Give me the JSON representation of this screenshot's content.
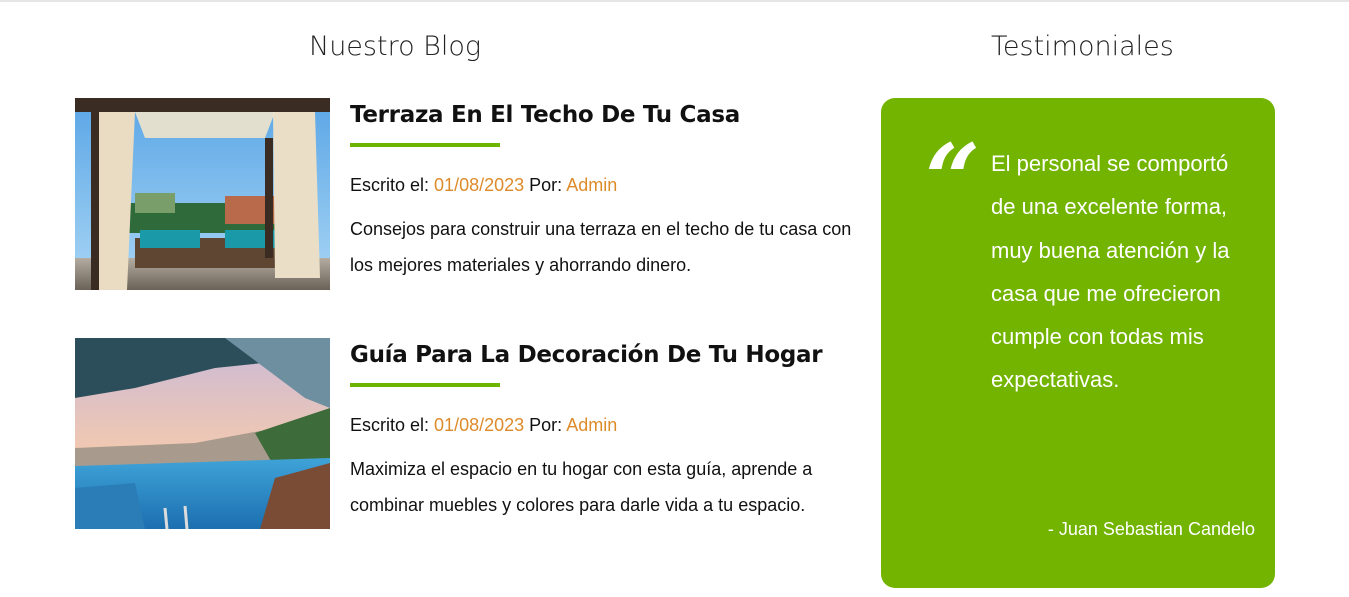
{
  "blog": {
    "heading": "Nuestro Blog",
    "posts": [
      {
        "title": "Terraza En El Techo De Tu Casa",
        "meta_written": "Escrito el:",
        "date": "01/08/2023",
        "meta_by": "Por:",
        "author": "Admin",
        "excerpt": "Consejos para construir una terraza en el techo de tu casa con los mejores materiales y ahorrando dinero.",
        "image": "rooftop-terrace-photo"
      },
      {
        "title": "Guía Para La Decoración De Tu Hogar",
        "meta_written": "Escrito el:",
        "date": "01/08/2023",
        "meta_by": "Por:",
        "author": "Admin",
        "excerpt": "Maximiza el espacio en tu hogar con esta guía, aprende a combinar muebles y colores para darle vida a tu espacio.",
        "image": "infinity-pool-photo"
      }
    ]
  },
  "testimonials": {
    "heading": "Testimoniales",
    "quote_icon": "quote-icon",
    "quote": "El personal se comportó de una excelente forma, muy buena atención y la casa que me ofrecieron cumple con todas mis expectativas.",
    "author": "- Juan Sebastian Candelo"
  },
  "colors": {
    "accent_green": "#72b400",
    "accent_orange": "#dd8b2a"
  }
}
